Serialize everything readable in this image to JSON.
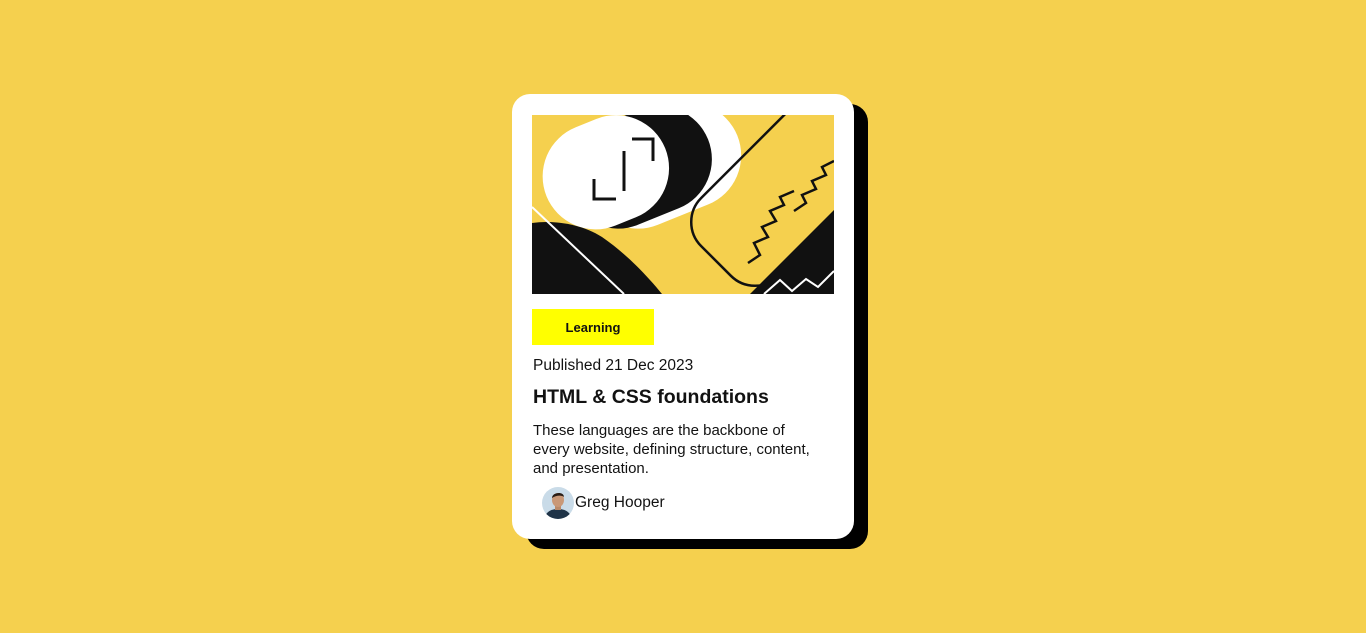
{
  "card": {
    "tag_label": "Learning",
    "published": "Published 21 Dec 2023",
    "title": "HTML & CSS foundations",
    "description": "These languages are the backbone of every website, defining structure, content, and presentation.",
    "author_name": "Greg Hooper"
  },
  "colors": {
    "page_background": "#f5d04e",
    "card_background": "#ffffff",
    "shadow": "#000000",
    "tag_background": "#ffff00",
    "text": "#121212"
  },
  "icons": {
    "hero": "illustration-article-image",
    "avatar": "author-avatar-image"
  }
}
